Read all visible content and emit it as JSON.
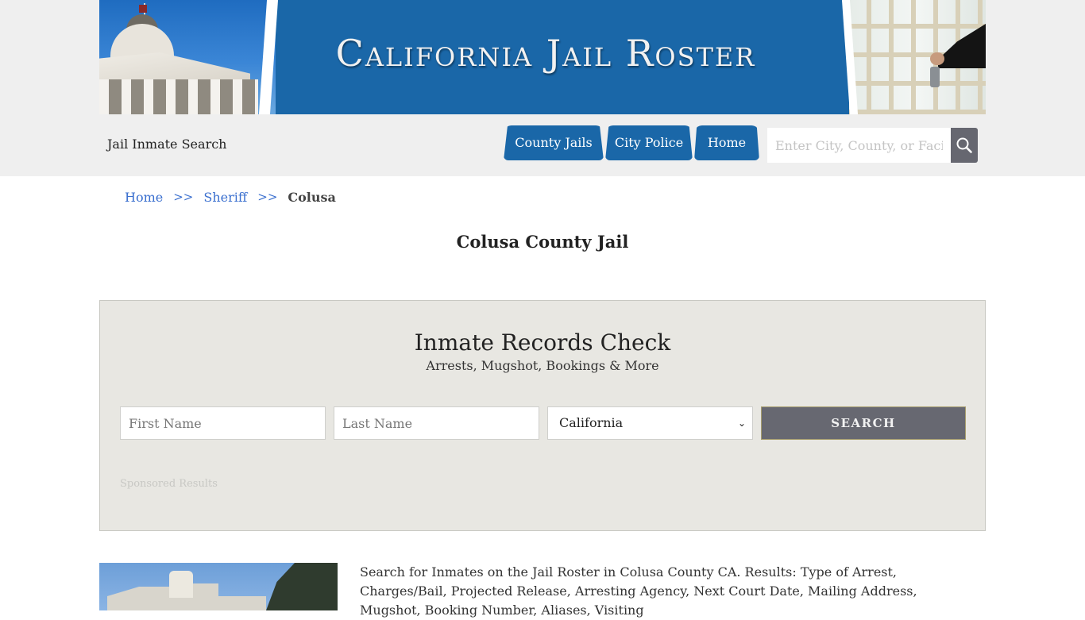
{
  "header": {
    "banner_title": "California Jail Roster",
    "brand_link": "Jail Inmate Search",
    "nav": [
      {
        "label": "County Jails"
      },
      {
        "label": "City Police"
      },
      {
        "label": "Home"
      }
    ],
    "search": {
      "placeholder": "Enter City, County, or Facility",
      "value": "",
      "button_icon": "search-icon"
    },
    "colors": {
      "brand_blue": "#1a67a8",
      "search_button": "#666770"
    }
  },
  "breadcrumb": {
    "items": [
      {
        "label": "Home"
      },
      {
        "label": "Sheriff"
      }
    ],
    "separator": ">>",
    "current": "Colusa"
  },
  "page": {
    "title": "Colusa County Jail"
  },
  "records_check": {
    "title": "Inmate Records Check",
    "subtitle": "Arrests, Mugshot, Bookings & More",
    "first_name_placeholder": "First Name",
    "last_name_placeholder": "Last Name",
    "state_selected": "California",
    "submit_label": "SEARCH",
    "sponsored_label": "Sponsored Results"
  },
  "intro": {
    "text": "Search for Inmates on the Jail Roster in Colusa County CA. Results: Type of Arrest, Charges/Bail, Projected Release, Arresting Agency, Next Court Date, Mailing Address, Mugshot, Booking Number, Aliases, Visiting"
  }
}
